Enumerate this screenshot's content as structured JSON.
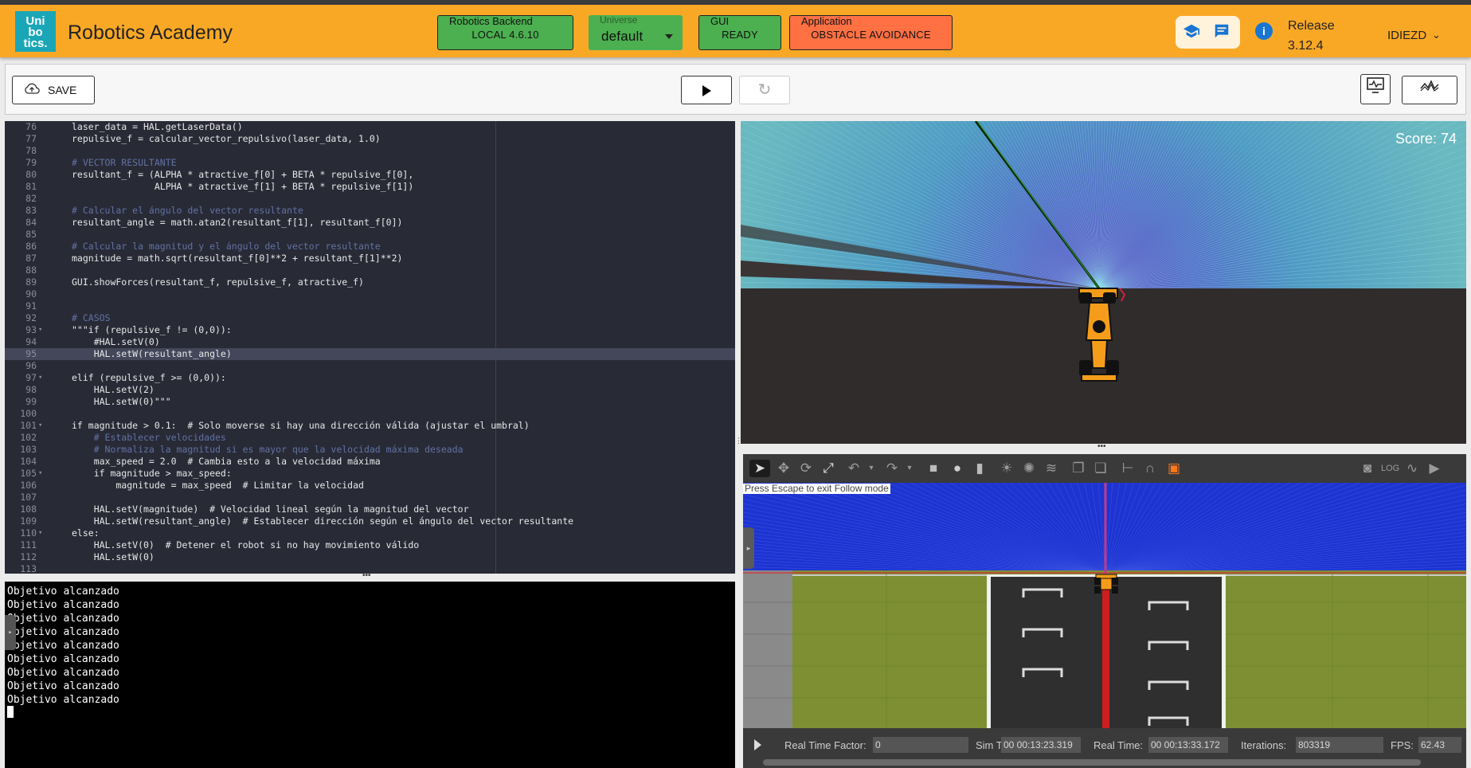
{
  "header": {
    "logo_text": [
      "Uni",
      "bo",
      "tics."
    ],
    "title": "Robotics Academy",
    "backend": {
      "caption": "Robotics Backend",
      "value": "LOCAL 4.6.10"
    },
    "universe": {
      "caption": "Universe",
      "value": "default"
    },
    "gui": {
      "caption": "GUI",
      "value": "READY"
    },
    "application": {
      "caption": "Application",
      "value": "OBSTACLE AVOIDANCE"
    },
    "release_label": "Release",
    "release_version": "3.12.4",
    "user": "IDIEZD",
    "colors": {
      "header_bg": "#f9a826",
      "status_ok": "#4caf50",
      "app_button": "#ff7043",
      "icon_blue": "#1976d2"
    }
  },
  "toolbar": {
    "save_label": "SAVE"
  },
  "editor": {
    "lines": [
      {
        "n": "76",
        "f": "",
        "t": "laser_data = HAL.getLaserData()"
      },
      {
        "n": "77",
        "f": "",
        "t": "repulsive_f = calcular_vector_repulsivo(laser_data, 1.0)"
      },
      {
        "n": "78",
        "f": "",
        "t": ""
      },
      {
        "n": "79",
        "f": "",
        "t": "# VECTOR RESULTANTE",
        "c": true
      },
      {
        "n": "80",
        "f": "",
        "t": "resultant_f = (ALPHA * atractive_f[0] + BETA * repulsive_f[0],"
      },
      {
        "n": "81",
        "f": "",
        "t": "               ALPHA * atractive_f[1] + BETA * repulsive_f[1])"
      },
      {
        "n": "82",
        "f": "",
        "t": ""
      },
      {
        "n": "83",
        "f": "",
        "t": "# Calcular el ángulo del vector resultante",
        "c": true
      },
      {
        "n": "84",
        "f": "",
        "t": "resultant_angle = math.atan2(resultant_f[1], resultant_f[0])"
      },
      {
        "n": "85",
        "f": "",
        "t": ""
      },
      {
        "n": "86",
        "f": "",
        "t": "# Calcular la magnitud y el ángulo del vector resultante",
        "c": true
      },
      {
        "n": "87",
        "f": "",
        "t": "magnitude = math.sqrt(resultant_f[0]**2 + resultant_f[1]**2)"
      },
      {
        "n": "88",
        "f": "",
        "t": ""
      },
      {
        "n": "89",
        "f": "",
        "t": "GUI.showForces(resultant_f, repulsive_f, atractive_f)"
      },
      {
        "n": "90",
        "f": "",
        "t": ""
      },
      {
        "n": "91",
        "f": "",
        "t": ""
      },
      {
        "n": "92",
        "f": "",
        "t": "# CASOS",
        "c": true
      },
      {
        "n": "93",
        "f": "▾",
        "t": "\"\"\"if (repulsive_f != (0,0)):"
      },
      {
        "n": "94",
        "f": "",
        "t": "    #HAL.setV(0)"
      },
      {
        "n": "95",
        "f": "",
        "t": "    HAL.setW(resultant_angle)",
        "hl": true
      },
      {
        "n": "96",
        "f": "",
        "t": ""
      },
      {
        "n": "97",
        "f": "▾",
        "t": "elif (repulsive_f >= (0,0)):"
      },
      {
        "n": "98",
        "f": "",
        "t": "    HAL.setV(2)"
      },
      {
        "n": "99",
        "f": "",
        "t": "    HAL.setW(0)\"\"\""
      },
      {
        "n": "100",
        "f": "",
        "t": ""
      },
      {
        "n": "101",
        "f": "▾",
        "t": "if magnitude > 0.1:  # Solo moverse si hay una dirección válida (ajustar el umbral)"
      },
      {
        "n": "102",
        "f": "",
        "t": "    # Establecer velocidades",
        "c": true
      },
      {
        "n": "103",
        "f": "",
        "t": "    # Normaliza la magnitud si es mayor que la velocidad máxima deseada",
        "c": true
      },
      {
        "n": "104",
        "f": "",
        "t": "    max_speed = 2.0  # Cambia esto a la velocidad máxima"
      },
      {
        "n": "105",
        "f": "▾",
        "t": "    if magnitude > max_speed:"
      },
      {
        "n": "106",
        "f": "",
        "t": "        magnitude = max_speed  # Limitar la velocidad"
      },
      {
        "n": "107",
        "f": "",
        "t": ""
      },
      {
        "n": "108",
        "f": "",
        "t": "    HAL.setV(magnitude)  # Velocidad lineal según la magnitud del vector"
      },
      {
        "n": "109",
        "f": "",
        "t": "    HAL.setW(resultant_angle)  # Establecer dirección según el ángulo del vector resultante"
      },
      {
        "n": "110",
        "f": "▾",
        "t": "else:"
      },
      {
        "n": "111",
        "f": "",
        "t": "    HAL.setV(0)  # Detener el robot si no hay movimiento válido"
      },
      {
        "n": "112",
        "f": "",
        "t": "    HAL.setW(0)"
      },
      {
        "n": "113",
        "f": "",
        "t": ""
      }
    ],
    "zoom_in": "+",
    "zoom_out": "−"
  },
  "console": {
    "lines": [
      "Objetivo alcanzado",
      "Objetivo alcanzado",
      "Objetivo alcanzado",
      "Objetivo alcanzado",
      "Objetivo alcanzado",
      "Objetivo alcanzado",
      "Objetivo alcanzado",
      "Objetivo alcanzado",
      "Objetivo alcanzado"
    ]
  },
  "simulation": {
    "score": "Score: 74"
  },
  "gazebo": {
    "message": "Press Escape to exit Follow mode",
    "real_time_factor_label": "Real Time Factor:",
    "real_time_factor": "0",
    "sim_time_label": "Sim Time:",
    "sim_time": "00 00:13:23.319",
    "real_time_label": "Real Time:",
    "real_time": "00 00:13:33.172",
    "iterations_label": "Iterations:",
    "iterations": "803319",
    "fps_label": "FPS:",
    "fps": "62.43"
  }
}
